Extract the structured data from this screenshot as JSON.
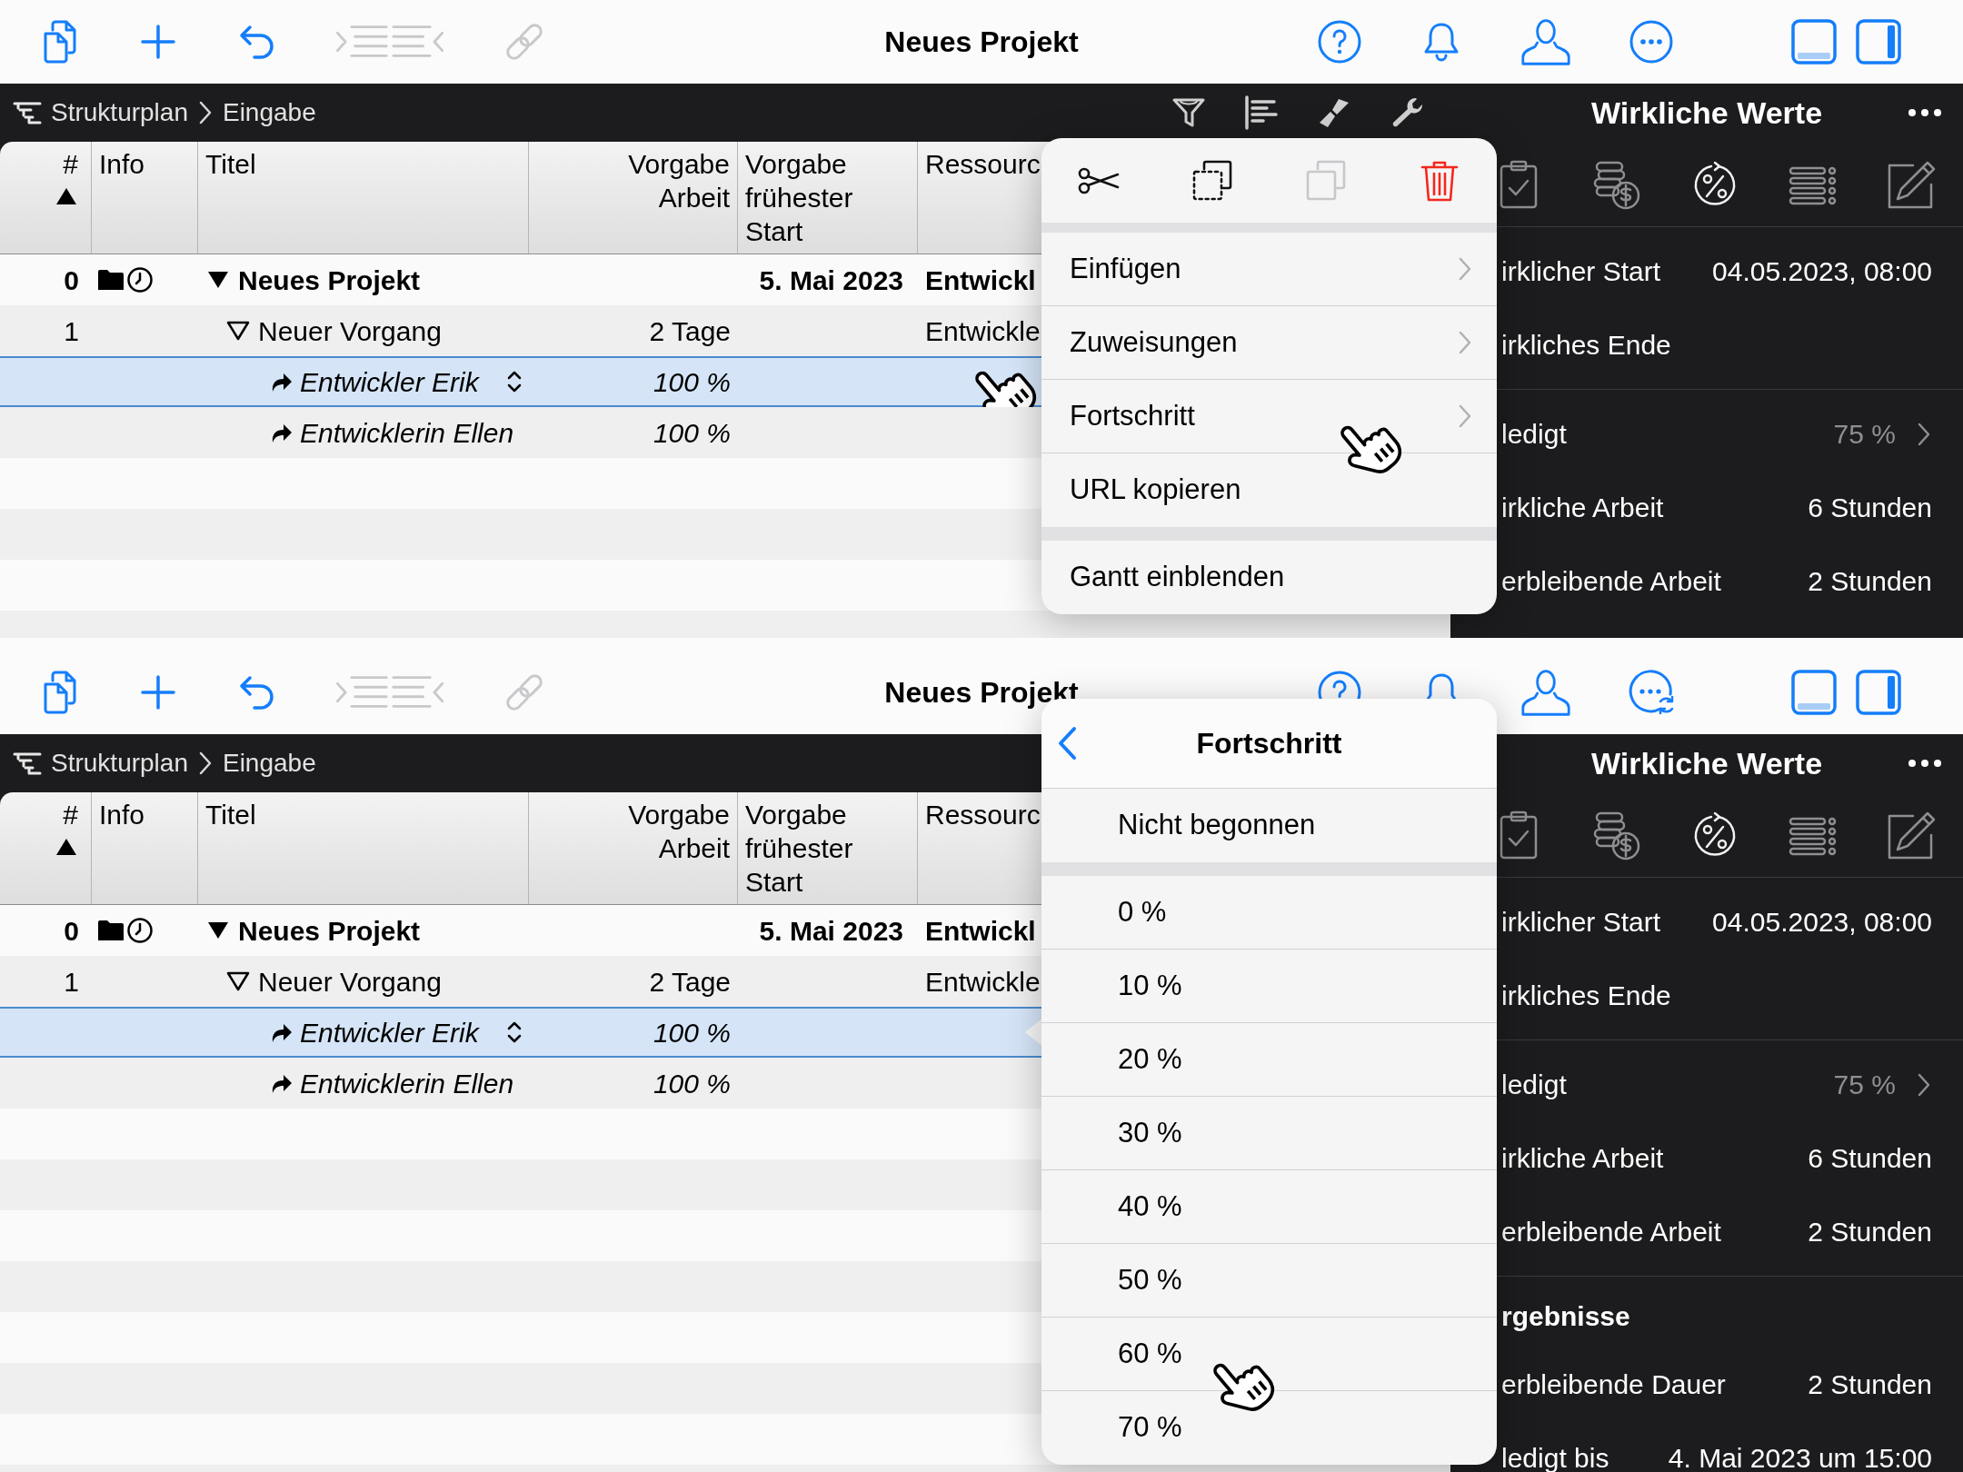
{
  "panels": [
    {
      "toolbar": {
        "title": "Neues Projekt",
        "tools": [
          {
            "disabled": false
          },
          {
            "disabled": false
          },
          {
            "disabled": false
          },
          {
            "disabled": true
          },
          {
            "disabled": true
          }
        ],
        "sync_pending": false
      },
      "breadcrumb": [
        "Strukturplan",
        "Eingabe"
      ],
      "tools_visible": true,
      "table": {
        "columns": [
          {
            "label": "#",
            "sorted": true
          },
          {
            "label": "Info",
            "sorted": false
          },
          {
            "label": "Titel",
            "sorted": false
          },
          {
            "label": "Vorgabe\nArbeit",
            "sorted": false
          },
          {
            "label": "Vorgabe\nfrühester\nStart",
            "sorted": false
          },
          {
            "label": "Ressourc",
            "sorted": false
          }
        ],
        "rows": [
          {
            "number": "0",
            "title": "Neues Projekt",
            "start": "5. Mai 2023",
            "resource": "Entwickl",
            "expanded": true,
            "selected": false,
            "tapped": false,
            "anchor": false,
            "children": [
              {
                "number": "1",
                "title": "Neuer Vorgang",
                "work": "2 Tage",
                "resource": "Entwickle",
                "expanded": true,
                "selected": false,
                "tapped": false,
                "anchor": false,
                "children": [
                  {
                    "title": "Entwickler Erik",
                    "work": "100 %",
                    "selected": true,
                    "tapped": true,
                    "anchor": false
                  },
                  {
                    "title": "Entwicklerin Ellen",
                    "work": "100 %",
                    "selected": false,
                    "tapped": false,
                    "anchor": false
                  }
                ]
              }
            ]
          }
        ]
      },
      "inspector": {
        "title": "Wirkliche Werte",
        "tabs": [
          {
            "selected": false
          },
          {
            "selected": false
          },
          {
            "selected": true
          },
          {
            "selected": false
          },
          {
            "selected": false
          }
        ],
        "sections": [
          {
            "rows": [
              {
                "label": "irklicher Start",
                "value": "04.05.2023, 08:00",
                "disclosure": false
              },
              {
                "label": "irkliches Ende",
                "disclosure": false
              }
            ]
          },
          {
            "rows": [
              {
                "label": "ledigt",
                "value": "75 %",
                "disclosure": true
              },
              {
                "label": "irkliche Arbeit",
                "value": "6 Stunden",
                "disclosure": false
              },
              {
                "label": "erbleibende Arbeit",
                "value": "2 Stunden",
                "disclosure": false
              }
            ]
          }
        ]
      },
      "popover": {
        "kind": "menu",
        "actions": [
          {
            "disabled": false,
            "destructive": false
          },
          {
            "disabled": false,
            "destructive": false
          },
          {
            "disabled": true,
            "destructive": false
          },
          {
            "disabled": false,
            "destructive": true
          }
        ],
        "groups": [
          {
            "items": [
              {
                "label": "Einfügen",
                "submenu": true,
                "tapped": false
              },
              {
                "label": "Zuweisungen",
                "submenu": true,
                "tapped": false
              },
              {
                "label": "Fortschritt",
                "submenu": true,
                "tapped": true
              },
              {
                "label": "URL kopieren",
                "submenu": false,
                "tapped": false
              }
            ]
          },
          {
            "items": [
              {
                "label": "Gantt einblenden",
                "submenu": false,
                "tapped": false
              }
            ]
          }
        ]
      }
    },
    {
      "toolbar": {
        "title": "Neues Projekt",
        "tools": [
          {
            "disabled": false
          },
          {
            "disabled": false
          },
          {
            "disabled": false
          },
          {
            "disabled": true
          },
          {
            "disabled": true
          }
        ],
        "sync_pending": true
      },
      "breadcrumb": [
        "Strukturplan",
        "Eingabe"
      ],
      "tools_visible": false,
      "table": {
        "columns": [
          {
            "label": "#",
            "sorted": true
          },
          {
            "label": "Info",
            "sorted": false
          },
          {
            "label": "Titel",
            "sorted": false
          },
          {
            "label": "Vorgabe\nArbeit",
            "sorted": false
          },
          {
            "label": "Vorgabe\nfrühester\nStart",
            "sorted": false
          },
          {
            "label": "Ressourc",
            "sorted": false
          }
        ],
        "rows": [
          {
            "number": "0",
            "title": "Neues Projekt",
            "start": "5. Mai 2023",
            "resource": "Entwickl",
            "expanded": true,
            "selected": false,
            "tapped": false,
            "anchor": false,
            "children": [
              {
                "number": "1",
                "title": "Neuer Vorgang",
                "work": "2 Tage",
                "resource": "Entwickle",
                "expanded": true,
                "selected": false,
                "tapped": false,
                "anchor": false,
                "children": [
                  {
                    "title": "Entwickler Erik",
                    "work": "100 %",
                    "selected": true,
                    "tapped": false,
                    "anchor": true
                  },
                  {
                    "title": "Entwicklerin Ellen",
                    "work": "100 %",
                    "selected": false,
                    "tapped": false,
                    "anchor": false
                  }
                ]
              }
            ]
          }
        ]
      },
      "inspector": {
        "title": "Wirkliche Werte",
        "tabs": [
          {
            "selected": false
          },
          {
            "selected": false
          },
          {
            "selected": true
          },
          {
            "selected": false
          },
          {
            "selected": false
          }
        ],
        "sections": [
          {
            "rows": [
              {
                "label": "irklicher Start",
                "value": "04.05.2023, 08:00",
                "disclosure": false
              },
              {
                "label": "irkliches Ende",
                "disclosure": false
              }
            ]
          },
          {
            "rows": [
              {
                "label": "ledigt",
                "value": "75 %",
                "disclosure": true
              },
              {
                "label": "irkliche Arbeit",
                "value": "6 Stunden",
                "disclosure": false
              },
              {
                "label": "erbleibende Arbeit",
                "value": "2 Stunden",
                "disclosure": false
              }
            ]
          },
          {
            "heading": "rgebnisse",
            "rows": [
              {
                "label": "erbleibende Dauer",
                "value": "2 Stunden",
                "disclosure": false
              },
              {
                "label": "ledigt bis",
                "value": "4. Mai 2023 um 15:00",
                "disclosure": false
              }
            ]
          }
        ]
      },
      "popover": {
        "kind": "submenu",
        "title": "Fortschritt",
        "groups": [
          {
            "items": [
              {
                "label": "Nicht begonnen",
                "tapped": false
              }
            ]
          },
          {
            "items": [
              {
                "label": "0 %",
                "tapped": false
              },
              {
                "label": "10 %",
                "tapped": false
              },
              {
                "label": "20 %",
                "tapped": false
              },
              {
                "label": "30 %",
                "tapped": false
              },
              {
                "label": "40 %",
                "tapped": false
              },
              {
                "label": "50 %",
                "tapped": false
              },
              {
                "label": "60 %",
                "tapped": true
              },
              {
                "label": "70 %",
                "tapped": false
              }
            ]
          }
        ]
      }
    }
  ]
}
